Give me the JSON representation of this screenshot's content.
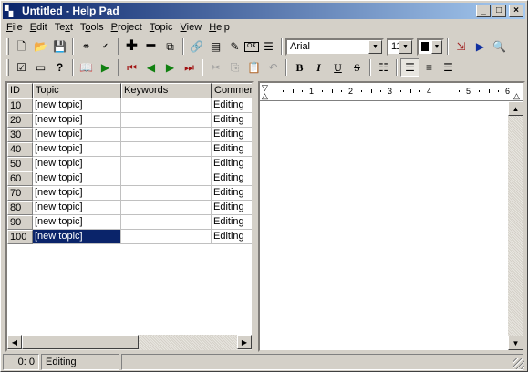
{
  "window": {
    "title": "Untitled - Help Pad",
    "app_icon": "help-pad-icon",
    "buttons": {
      "minimize": "_",
      "maximize": "□",
      "close": "×"
    }
  },
  "menu": [
    "File",
    "Edit",
    "Text",
    "Tools",
    "Project",
    "Topic",
    "View",
    "Help"
  ],
  "menu_access": [
    "F",
    "E",
    "x",
    "o",
    "P",
    "T",
    "V",
    "H"
  ],
  "toolbar1": {
    "icons": [
      "new-document-icon",
      "open-folder-icon",
      "save-icon",
      "find-binoculars-icon",
      "spellcheck-icon",
      "add-topic-icon",
      "remove-topic-icon",
      "topic-properties-icon",
      "link-icon",
      "insert-page-icon",
      "edit-page-icon",
      "ok-button-icon",
      "list-view-icon",
      "export-icon",
      "compile-play-icon",
      "preview-search-icon"
    ],
    "font_name": "Arial",
    "font_size": "11",
    "color_swatch": "#000000"
  },
  "toolbar2": {
    "icons": [
      "checklist-icon",
      "browse-sequence-icon",
      "help-question-icon",
      "book-icon",
      "run-icon",
      "first-topic-icon",
      "prev-topic-icon",
      "next-topic-icon",
      "last-topic-icon",
      "cut-icon",
      "copy-icon",
      "paste-icon",
      "undo-icon",
      "bold-icon",
      "italic-icon",
      "underline-icon",
      "strikethrough-icon",
      "bullets-icon",
      "align-left-icon",
      "align-center-icon",
      "align-right-icon"
    ],
    "format_labels": {
      "bold": "B",
      "italic": "I",
      "underline": "U",
      "strike": "S"
    }
  },
  "topic_list": {
    "columns": [
      "ID",
      "Topic",
      "Keywords",
      "Comment"
    ],
    "rows": [
      {
        "id": "10",
        "topic": "[new topic]",
        "keywords": "",
        "comment": "Editing"
      },
      {
        "id": "20",
        "topic": "[new topic]",
        "keywords": "",
        "comment": "Editing"
      },
      {
        "id": "30",
        "topic": "[new topic]",
        "keywords": "",
        "comment": "Editing"
      },
      {
        "id": "40",
        "topic": "[new topic]",
        "keywords": "",
        "comment": "Editing"
      },
      {
        "id": "50",
        "topic": "[new topic]",
        "keywords": "",
        "comment": "Editing"
      },
      {
        "id": "60",
        "topic": "[new topic]",
        "keywords": "",
        "comment": "Editing"
      },
      {
        "id": "70",
        "topic": "[new topic]",
        "keywords": "",
        "comment": "Editing"
      },
      {
        "id": "80",
        "topic": "[new topic]",
        "keywords": "",
        "comment": "Editing"
      },
      {
        "id": "90",
        "topic": "[new topic]",
        "keywords": "",
        "comment": "Editing"
      },
      {
        "id": "100",
        "topic": "[new topic]",
        "keywords": "",
        "comment": "Editing"
      }
    ],
    "selected_id": "100"
  },
  "ruler": {
    "numbers": [
      "1",
      "2",
      "3",
      "4",
      "5",
      "6"
    ]
  },
  "status": {
    "position": "0: 0",
    "mode": "Editing",
    "extra": ""
  },
  "colors": {
    "selection": "#0a246a",
    "titlebar_start": "#0a246a",
    "titlebar_end": "#a6caf0",
    "face": "#d4d0c8"
  }
}
